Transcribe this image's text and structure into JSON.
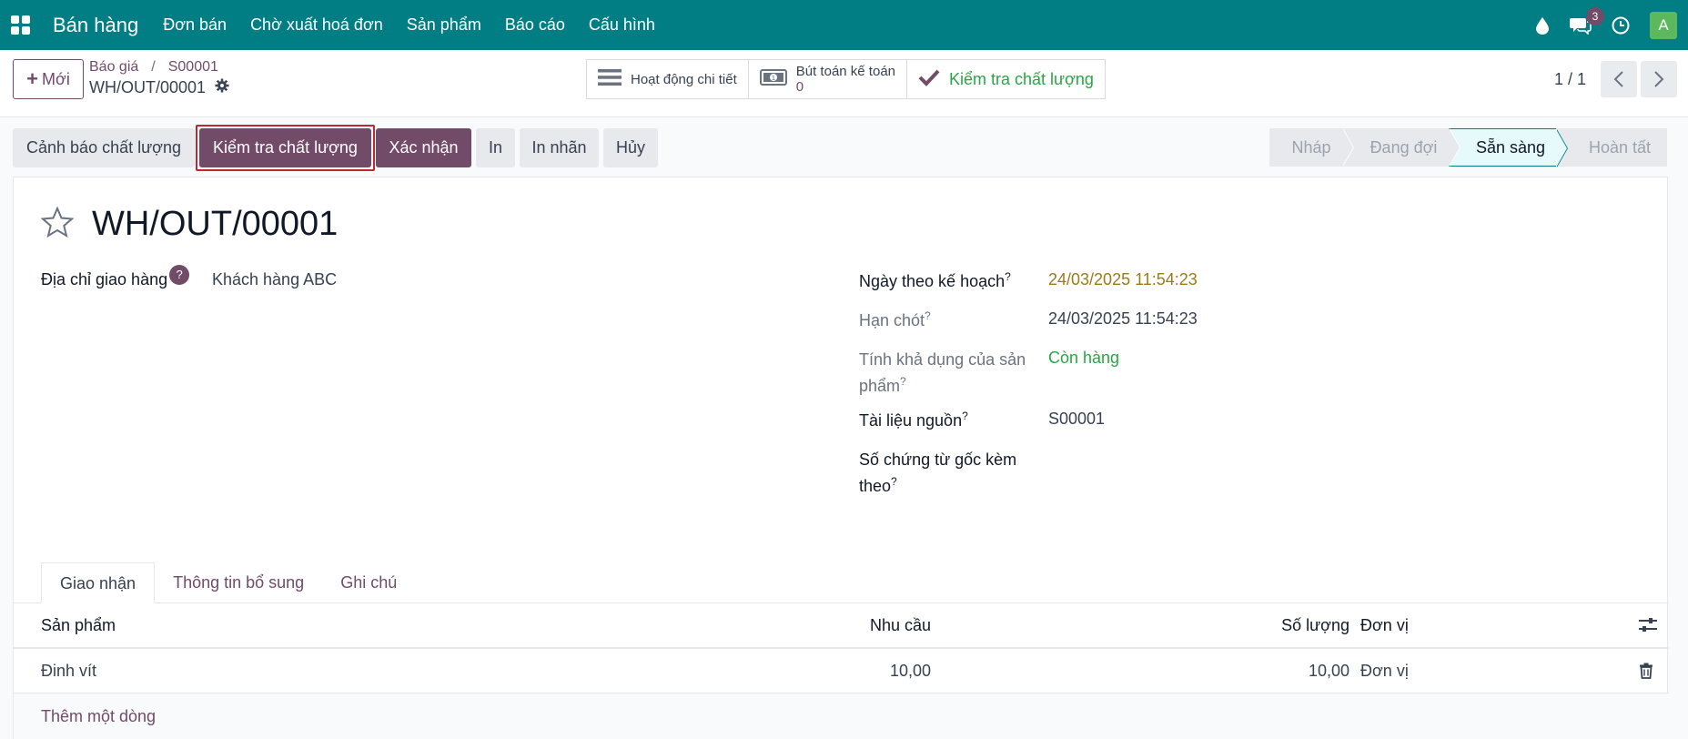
{
  "navbar": {
    "brand": "Bán hàng",
    "menu": [
      "Đơn bán",
      "Chờ xuất hoá đơn",
      "Sản phẩm",
      "Báo cáo",
      "Cấu hình"
    ],
    "chat_badge": "3",
    "avatar_letter": "A"
  },
  "control": {
    "new_button": "Mới",
    "breadcrumb": [
      "Báo giá",
      "S00001"
    ],
    "record_name": "WH/OUT/00001",
    "smart_buttons": {
      "activity": "Hoạt động chi tiết",
      "journal_label": "Bút toán kế toán",
      "journal_value": "0",
      "quality_check": "Kiểm tra chất lượng"
    },
    "pager": "1 / 1"
  },
  "actions": {
    "quality_alert": "Cảnh báo chất lượng",
    "quality_check": "Kiểm tra chất lượng",
    "confirm": "Xác nhận",
    "print": "In",
    "print_label": "In nhãn",
    "cancel": "Hủy"
  },
  "status_stages": [
    "Nháp",
    "Đang đợi",
    "Sẵn sàng",
    "Hoàn tất"
  ],
  "current_stage": "Sẵn sàng",
  "form": {
    "title": "WH/OUT/00001",
    "delivery_address_label": "Địa chỉ giao hàng",
    "delivery_address_value": "Khách hàng ABC",
    "scheduled_date_label": "Ngày theo kế hoạch",
    "scheduled_date_value": "24/03/2025 11:54:23",
    "deadline_label": "Hạn chót",
    "deadline_value": "24/03/2025 11:54:23",
    "availability_label_1": "Tính khả dụng của sản",
    "availability_label_2": "phẩm",
    "availability_value": "Còn hàng",
    "source_doc_label": "Tài liệu nguồn",
    "source_doc_value": "S00001",
    "origin_doc_label_1": "Số chứng từ gốc kèm",
    "origin_doc_label_2": "theo",
    "help_mark": "?"
  },
  "tabs": [
    "Giao nhận",
    "Thông tin bổ sung",
    "Ghi chú"
  ],
  "table": {
    "headers": {
      "product": "Sản phẩm",
      "demand": "Nhu cầu",
      "quantity": "Số lượng",
      "uom": "Đơn vị"
    },
    "rows": [
      {
        "product": "Đinh vít",
        "demand": "10,00",
        "quantity": "10,00",
        "uom": "Đơn vị"
      }
    ],
    "add_line": "Thêm một dòng"
  },
  "colors": {
    "navbar": "#017e84",
    "primary": "#714b67",
    "success": "#28a745",
    "highlight": "#c0282d"
  }
}
